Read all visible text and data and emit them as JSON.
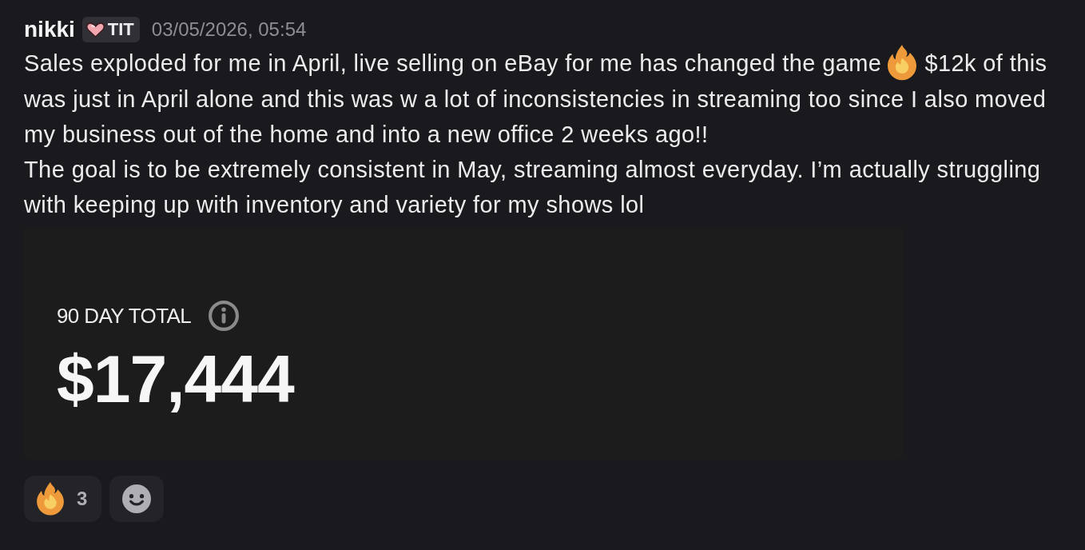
{
  "message": {
    "author": "nikki",
    "tag": {
      "label": "TIT"
    },
    "timestamp": "03/05/2026, 05:54",
    "blocks": [
      {
        "segments": [
          {
            "kind": "text",
            "text": "Sales exploded for me in April, live selling on eBay for me has changed the game"
          },
          {
            "kind": "emoji"
          },
          {
            "kind": "text",
            "text": "$12k of this"
          }
        ]
      },
      {
        "segments": [
          {
            "kind": "text",
            "text": "was just in April alone and this was w a lot of inconsistencies in streaming too since I also moved my business out of the home and into a new office 2 weeks ago!!"
          }
        ]
      },
      {
        "segments": [
          {
            "kind": "text",
            "text": "The goal is to be extremely consistent in May, streaming almost everyday. I’m actually struggling with keeping up with inventory and variety for my shows lol"
          }
        ]
      }
    ],
    "embed": {
      "label": "90 DAY TOTAL",
      "value": "$17,444"
    },
    "reactions": [
      {
        "count": "3",
        "selected": false
      }
    ],
    "add_reaction_button": true
  }
}
